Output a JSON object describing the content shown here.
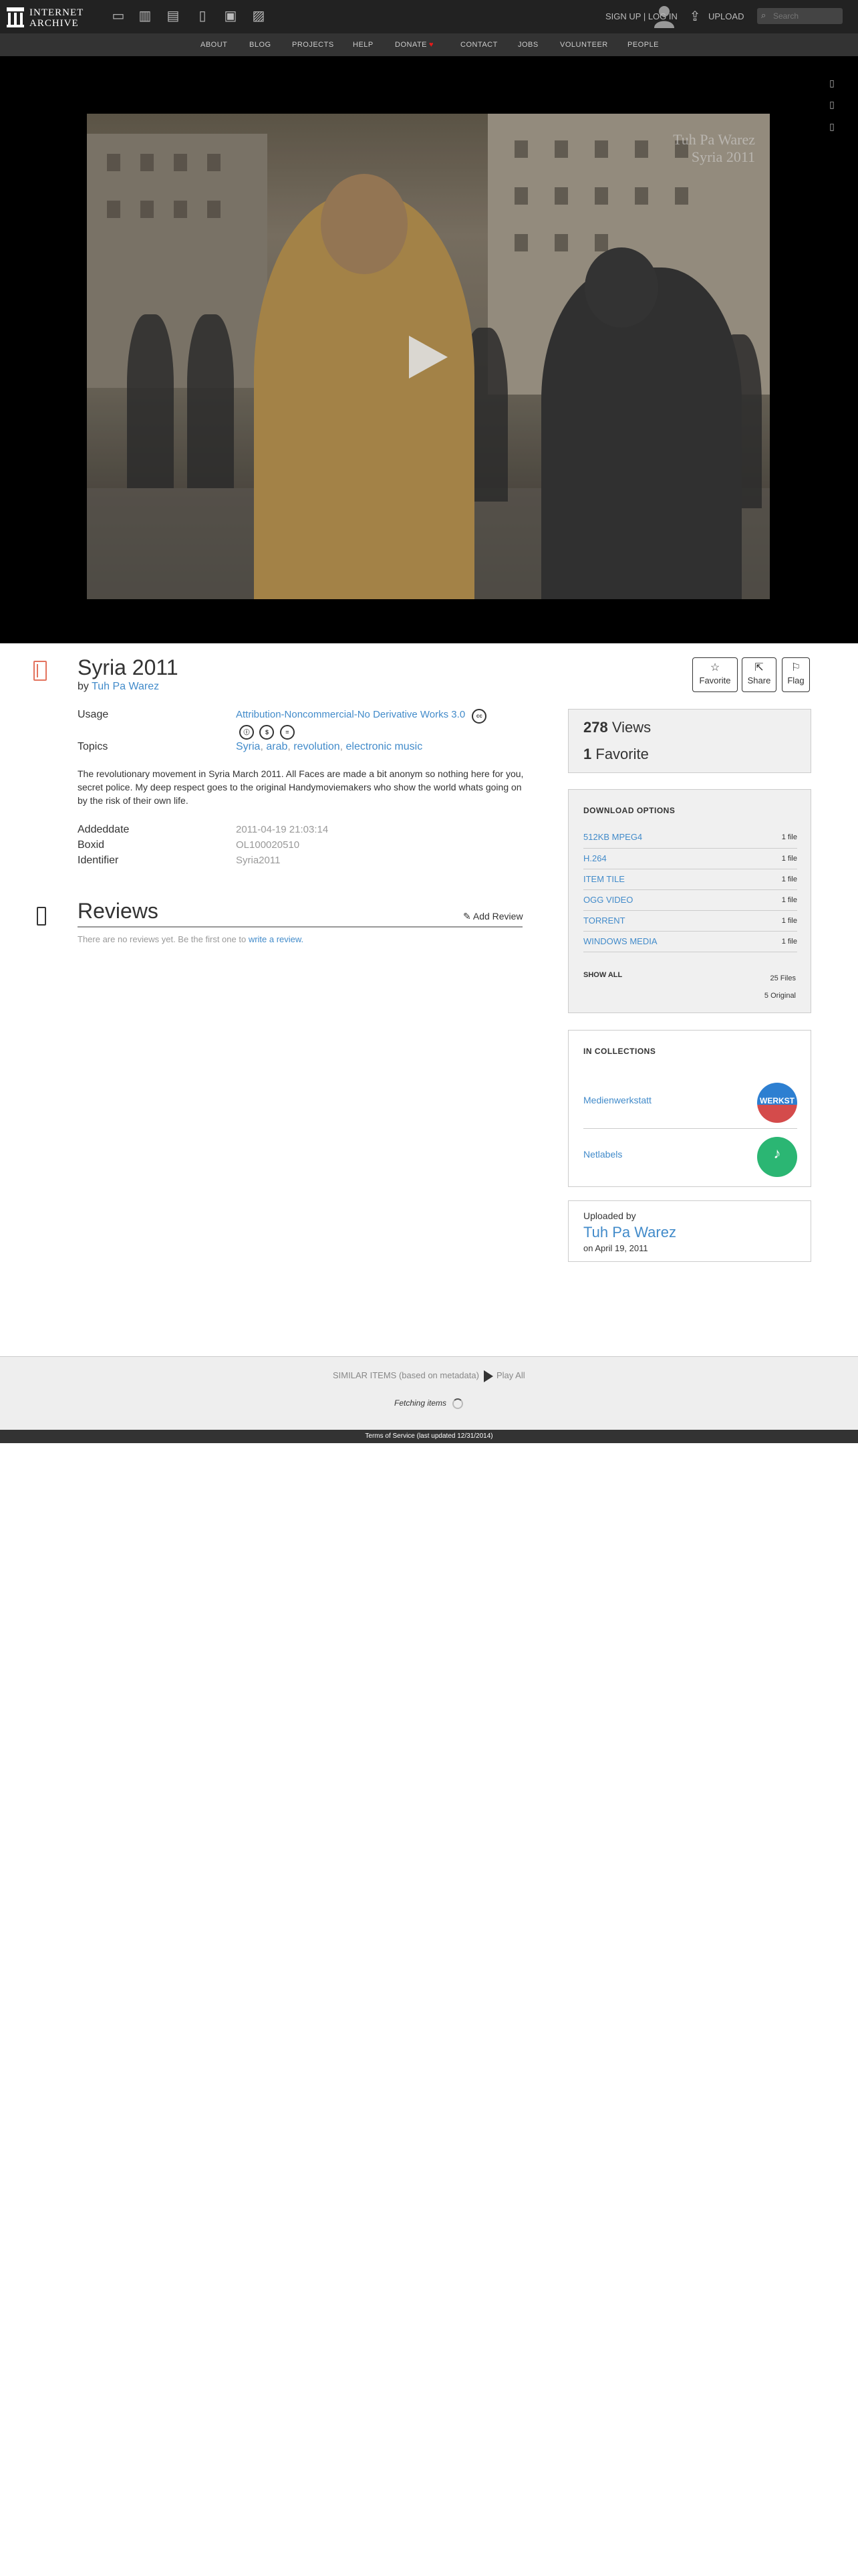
{
  "brand": {
    "line1": "INTERNET",
    "line2": "ARCHIVE"
  },
  "topnav": {
    "media_icons": [
      "web-icon",
      "texts-icon",
      "video-icon",
      "audio-icon",
      "software-icon",
      "images-icon"
    ],
    "signup": "SIGN UP | LOG IN",
    "upload": "UPLOAD",
    "search_placeholder": "Search"
  },
  "subnav": [
    "ABOUT",
    "BLOG",
    "PROJECTS",
    "HELP",
    "DONATE",
    "CONTACT",
    "JOBS",
    "VOLUNTEER",
    "PEOPLE"
  ],
  "video": {
    "watermark_line1": "Tuh Pa Warez",
    "watermark_line2": "Syria 2011"
  },
  "item": {
    "title": "Syria 2011",
    "by_prefix": "by",
    "creator": "Tuh Pa Warez",
    "actions": {
      "favorite": "Favorite",
      "share": "Share",
      "flag": "Flag"
    },
    "metadata": {
      "usage_label": "Usage",
      "usage_value": "Attribution-Noncommercial-No Derivative Works 3.0",
      "topics_label": "Topics",
      "topics": [
        "Syria",
        "arab",
        "revolution",
        "electronic music"
      ],
      "description": "The revolutionary movement in Syria March 2011. All Faces are made a bit anonym so nothing here for you, secret police. My deep respect goes to the original Handymoviemakers who show the world whats going on by the risk of their own life.",
      "addeddate_label": "Addeddate",
      "addeddate_value": "2011-04-19 21:03:14",
      "boxid_label": "Boxid",
      "boxid_value": "OL100020510",
      "identifier_label": "Identifier",
      "identifier_value": "Syria2011"
    }
  },
  "reviews": {
    "title": "Reviews",
    "add": "Add Review",
    "empty_text": "There are no reviews yet. Be the first one to",
    "empty_link": "write a review."
  },
  "stats": {
    "views": "278",
    "views_label": "Views",
    "favorites": "1",
    "favorites_label": "Favorite"
  },
  "downloads": {
    "title": "DOWNLOAD OPTIONS",
    "rows": [
      {
        "format": "512KB MPEG4",
        "count": "1 file"
      },
      {
        "format": "H.264",
        "count": "1 file"
      },
      {
        "format": "ITEM TILE",
        "count": "1 file"
      },
      {
        "format": "OGG VIDEO",
        "count": "1 file"
      },
      {
        "format": "TORRENT",
        "count": "1 file"
      },
      {
        "format": "WINDOWS MEDIA",
        "count": "1 file"
      }
    ],
    "show_all": "SHOW ALL",
    "total_files": "25 Files",
    "original_files": "5 Original"
  },
  "collections": {
    "title": "IN COLLECTIONS",
    "items": [
      {
        "name": "Medienwerkstatt",
        "logo_text": "WERKST"
      },
      {
        "name": "Netlabels",
        "logo_text": "♪"
      }
    ]
  },
  "uploader": {
    "label": "Uploaded by",
    "name": "Tuh Pa Warez",
    "date": "on April 19, 2011"
  },
  "similar": {
    "label": "SIMILAR ITEMS (based on metadata)",
    "play_all": "Play All",
    "fetching": "Fetching items"
  },
  "footer": {
    "terms": "Terms of Service (last updated 12/31/2014)"
  },
  "colors": {
    "link": "#428bca",
    "topbar": "#222222",
    "subbar": "#333333",
    "accent_red": "#e51b1b"
  }
}
